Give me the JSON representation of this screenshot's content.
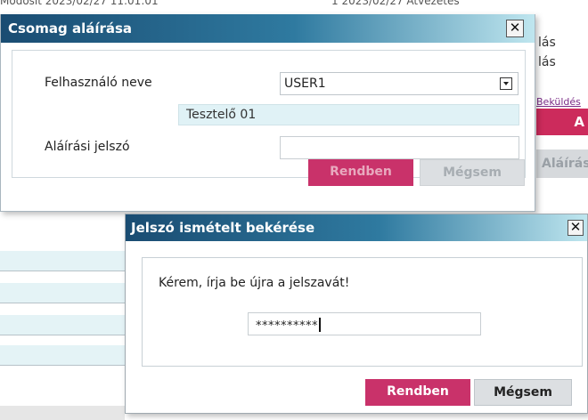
{
  "background": {
    "top_row_left": "Módosít 2023/02/27 11:01:01",
    "top_row_right": "1 2023/02/27 Átvezetés",
    "right_texts": [
      "lás",
      "lás"
    ],
    "right_link": "Beküldés",
    "right_button_a": "A",
    "right_button_b": "Aláírás"
  },
  "dialog1": {
    "title": "Csomag aláírása",
    "close_glyph": "✕",
    "user_label": "Felhasználó neve",
    "user_select_value": "USER1",
    "user_full_name": "Tesztelő 01",
    "password_label": "Aláírási jelszó",
    "password_value": "",
    "ok_label": "Rendben",
    "cancel_label": "Mégsem"
  },
  "dialog2": {
    "title": "Jelszó ismételt bekérése",
    "close_glyph": "✕",
    "prompt": "Kérem, írja be újra a jelszavát!",
    "password_mask": "**********",
    "ok_label": "Rendben",
    "cancel_label": "Mégsem"
  },
  "colors": {
    "title_dark": "#1a4c72",
    "title_light": "#bfe6ef",
    "primary_button": "#c9326a",
    "secondary_button": "#dcdfe2",
    "readonly_field": "#e0f2f6"
  }
}
